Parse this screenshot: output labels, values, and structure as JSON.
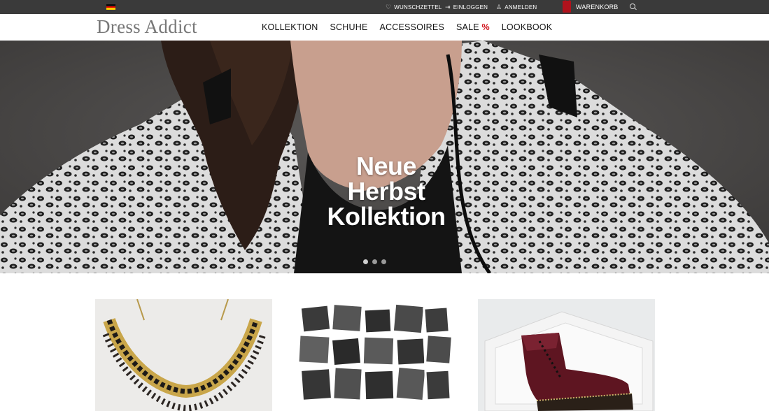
{
  "language": {
    "flag_icon": "germany-flag-icon",
    "colors": [
      "#111111",
      "#dd0000",
      "#ffcc00"
    ]
  },
  "utility_nav": {
    "wishlist": {
      "label": "WUNSCHZETTEL",
      "icon": "heart-icon"
    },
    "login": {
      "label": "EINLOGGEN",
      "icon": "login-arrow-icon"
    },
    "register": {
      "label": "ANMELDEN",
      "icon": "user-icon"
    },
    "cart": {
      "label": "WARENKORB",
      "icon": "shopping-bag-icon",
      "color": "#b0121c"
    },
    "search": {
      "icon": "search-icon"
    }
  },
  "logo": {
    "text": "Dress Addict"
  },
  "main_nav": [
    {
      "label": "KOLLEKTION"
    },
    {
      "label": "SCHUHE"
    },
    {
      "label": "ACCESSOIRES"
    },
    {
      "label": "SALE",
      "badge": "%"
    },
    {
      "label": "LOOKBOOK"
    }
  ],
  "hero": {
    "title_lines": [
      "Neue",
      "Herbst",
      "Kollektion"
    ],
    "slides_total": 3,
    "active_slide": 1
  },
  "tiles": [
    {
      "image": "necklace-photo"
    },
    {
      "image": "lookbook-collage-photo"
    },
    {
      "image": "red-boot-photo"
    }
  ],
  "colors": {
    "topbar": "#3a3a3a",
    "sale_accent": "#d0121b",
    "logo": "#777777"
  }
}
